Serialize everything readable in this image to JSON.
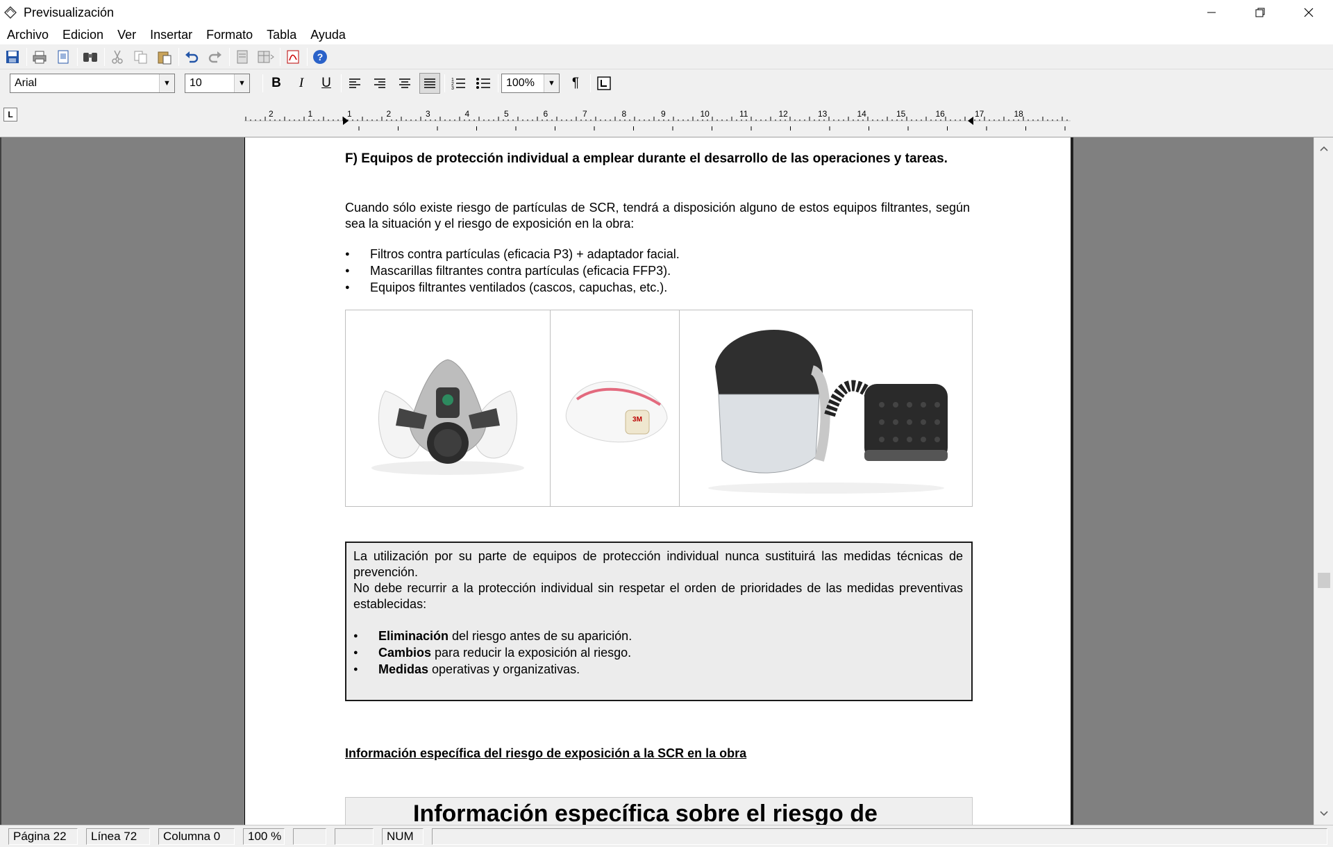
{
  "window": {
    "title": "Previsualización"
  },
  "menu": [
    "Archivo",
    "Edicion",
    "Ver",
    "Insertar",
    "Formato",
    "Tabla",
    "Ayuda"
  ],
  "toolbar": {
    "font": "Arial",
    "size": "10",
    "zoom": "100%",
    "bold_label": "B",
    "italic_label": "I",
    "underline_label": "U",
    "pilcrow_label": "¶"
  },
  "ruler": {
    "labels": [
      "2",
      "1",
      "1",
      "2",
      "3",
      "4",
      "5",
      "6",
      "7",
      "8",
      "9",
      "10",
      "11",
      "12",
      "13",
      "14",
      "15",
      "16",
      "17",
      "18"
    ]
  },
  "document": {
    "heading": "F) Equipos de protección individual a emplear durante el desarrollo de las operaciones y tareas.",
    "paragraph": "Cuando sólo existe riesgo de partículas de SCR, tendrá a disposición alguno de estos equipos filtrantes, según sea la situación y el riesgo de exposición en la obra:",
    "bullets": [
      "Filtros contra partículas (eficacia P3) + adaptador facial.",
      "Mascarillas filtrantes contra partículas (eficacia FFP3).",
      "Equipos filtrantes ventilados (cascos, capuchas, etc.)."
    ],
    "notice": {
      "line1": "La utilización por su parte de equipos de protección individual nunca sustituirá las medidas técnicas de prevención.",
      "line2": "No debe recurrir a la protección individual sin respetar el orden de prioridades de las medidas preventivas establecidas:",
      "items": [
        {
          "bold": "Eliminación",
          "rest": " del riesgo antes de su aparición."
        },
        {
          "bold": "Cambios",
          "rest": " para reducir la exposición al riesgo."
        },
        {
          "bold": "Medidas",
          "rest": " operativas y organizativas."
        }
      ]
    },
    "link_heading": "Información específica del riesgo de exposición a la SCR en la obra",
    "big_title": "Información específica sobre el riesgo de"
  },
  "status": {
    "page": "Página 22",
    "line": "Línea 72",
    "column": "Columna  0",
    "zoom": "100 %",
    "num": "NUM"
  }
}
